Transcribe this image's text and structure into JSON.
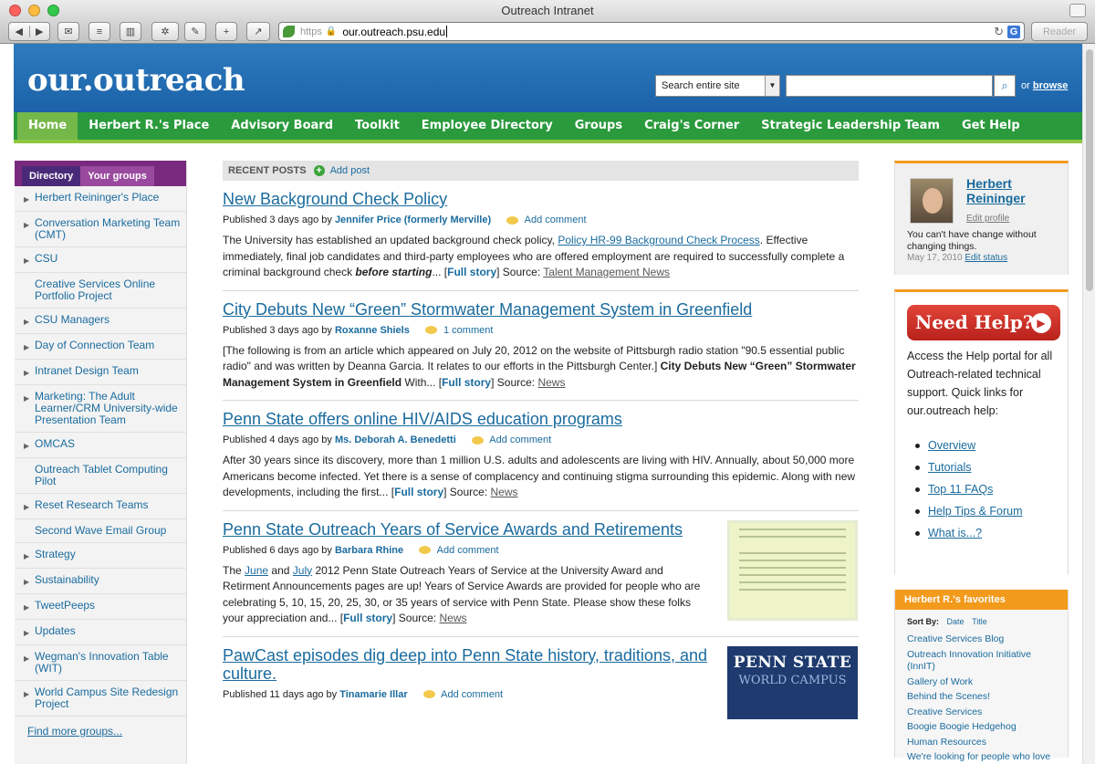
{
  "window": {
    "title": "Outreach Intranet"
  },
  "browser": {
    "url_scheme": "https",
    "url": "our.outreach.psu.edu",
    "reader_label": "Reader",
    "back_glyph": "◀",
    "forward_glyph": "▶",
    "reload_glyph": "↻",
    "google_glyph": "G",
    "lock_glyph": "🔒",
    "toolbar_glyphs": [
      "✉",
      "≡",
      "▥",
      "✲",
      "✎",
      "+",
      "↗"
    ],
    "lights": [
      "#fc615d",
      "#fdbc40",
      "#34c84a"
    ]
  },
  "site": {
    "logo": "our.outreach",
    "search_scope": "Search entire site",
    "search_placeholder": "",
    "search_icon": "⌕",
    "scope_arrow": "▼",
    "or_label": "or",
    "browse_label": "browse"
  },
  "nav": [
    "Home",
    "Herbert R.'s Place",
    "Advisory Board",
    "Toolkit",
    "Employee Directory",
    "Groups",
    "Craig's Corner",
    "Strategic Leadership Team",
    "Get Help"
  ],
  "sidebar": {
    "tab_directory": "Directory",
    "tab_groups": "Your groups",
    "groups": [
      {
        "label": "Herbert Reininger's Place",
        "arrow": true
      },
      {
        "label": "Conversation Marketing Team (CMT)",
        "arrow": true
      },
      {
        "label": "CSU",
        "arrow": true
      },
      {
        "label": "Creative Services Online Portfolio Project",
        "arrow": false
      },
      {
        "label": "CSU Managers",
        "arrow": true
      },
      {
        "label": "Day of Connection Team",
        "arrow": true
      },
      {
        "label": "Intranet Design Team",
        "arrow": true
      },
      {
        "label": "Marketing: The Adult Learner/CRM University-wide Presentation Team",
        "arrow": true
      },
      {
        "label": "OMCAS",
        "arrow": true
      },
      {
        "label": "Outreach Tablet Computing Pilot",
        "arrow": false
      },
      {
        "label": "Reset Research Teams",
        "arrow": true
      },
      {
        "label": "Second Wave Email Group",
        "arrow": false
      },
      {
        "label": "Strategy",
        "arrow": true
      },
      {
        "label": "Sustainability",
        "arrow": true
      },
      {
        "label": "TweetPeeps",
        "arrow": true
      },
      {
        "label": "Updates",
        "arrow": true
      },
      {
        "label": "Wegman's Innovation Table (WIT)",
        "arrow": true
      },
      {
        "label": "World Campus Site Redesign Project",
        "arrow": true
      }
    ],
    "find_more": "Find more groups..."
  },
  "posts": {
    "header": "RECENT POSTS",
    "add_post": "Add post",
    "plus_glyph": "+",
    "items": [
      {
        "title": "New Background Check Policy",
        "published": "Published 3 days ago by",
        "author": "Jennifer Price (formerly Merville)",
        "comment": "Add comment",
        "body_a": "The University has established an updated background check policy,",
        "link": "Policy HR-99 Background Check Process",
        "body_b": ". Effective immediately, final job candidates and third-party employees who are offered employment are required to successfully complete a criminal background check",
        "emph": "before starting",
        "body_c": "... [",
        "full": "Full story",
        "body_d": "]  Source:",
        "source": "Talent Management News"
      },
      {
        "title": "City Debuts New “Green” Stormwater Management System in Greenfield",
        "published": "Published 3 days ago by",
        "author": "Roxanne Shiels",
        "comment": "1 comment",
        "body_a": "[The following is from an article which appeared on July 20, 2012 on the website of  Pittsburgh radio station \"90.5 essential public radio\" and was written by Deanna Garcia. It relates to our efforts in the Pittsburgh Center.]",
        "bold": "City Debuts New “Green” Stormwater Management System in Greenfield",
        "body_b": " With... [",
        "full": "Full story",
        "body_c": "]  Source:",
        "source": "News"
      },
      {
        "title": "Penn State offers online HIV/AIDS education programs",
        "published": "Published 4 days ago by",
        "author": "Ms. Deborah A. Benedetti",
        "comment": "Add comment",
        "body_a": "After 30 years since its discovery, more than 1 million U.S. adults and adolescents are living with HIV. Annually, about 50,000 more Americans become infected. Yet there is a sense of complacency and continuing stigma surrounding this epidemic. Along with new developments, including the first... [",
        "full": "Full story",
        "body_b": "]  Source:",
        "source": "News"
      },
      {
        "title": "Penn State Outreach Years of Service Awards and Retirements",
        "published": "Published 6 days ago by",
        "author": "Barbara Rhine",
        "comment": "Add comment",
        "body_a": "The",
        "link1": "June",
        "body_b": "and",
        "link2": "July",
        "body_c": "2012 Penn State Outreach Years of Service at the University Award and Retirment Announcements pages are up!  Years of Service Awards are provided for people who are celebrating 5, 10, 15, 20, 25, 30, or 35 years of service with Penn State.  Please show these folks your appreciation and... [",
        "full": "Full story",
        "body_d": "]  Source:",
        "source": "News"
      },
      {
        "title": "PawCast episodes dig deep into Penn State history, traditions, and culture.",
        "published": "Published 11 days ago by",
        "author": "Tinamarie Illar",
        "comment": "Add comment",
        "image_line1": "PENN STATE",
        "image_line2": "WORLD CAMPUS"
      }
    ]
  },
  "profile": {
    "name": "Herbert Reininger",
    "edit_profile": "Edit profile",
    "status": "You can't have change without changing things.",
    "date": "May 17, 2010",
    "edit_status": "Edit status"
  },
  "help": {
    "button": "Need Help?",
    "play_glyph": "▶",
    "text": "Access the Help portal for all Outreach-related technical support. Quick links for our.outreach help:",
    "links": [
      "Overview",
      "Tutorials",
      "Top 11 FAQs",
      "Help Tips & Forum",
      "What is...?"
    ]
  },
  "favorites": {
    "header": "Herbert R.'s favorites",
    "sort_by": "Sort By:",
    "sort_date": "Date",
    "sort_title": "Title",
    "items": [
      "Creative Services Blog",
      "Outreach Innovation Initiative (InnIT)",
      "Gallery of Work",
      "Behind the Scenes!",
      "Creative Services",
      "Boogie Boogie Hedgehog",
      "Human Resources",
      "We're looking for people who love"
    ]
  }
}
